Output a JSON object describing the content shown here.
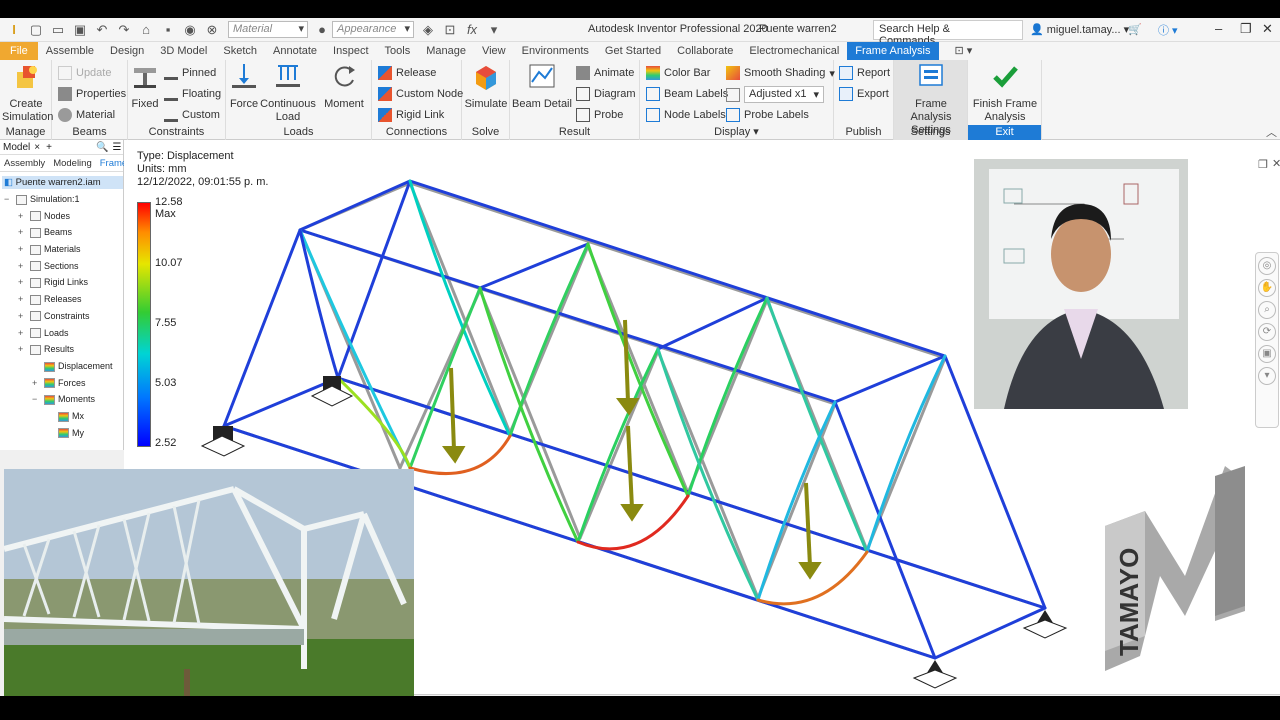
{
  "titlebar": {
    "material_placeholder": "Material",
    "appearance_placeholder": "Appearance",
    "app_title": "Autodesk Inventor Professional 2020",
    "doc_title": "Puente warren2",
    "search_placeholder": "Search Help & Commands...",
    "user": "miguel.tamay..."
  },
  "menu_tabs": [
    "File",
    "Assemble",
    "Design",
    "3D Model",
    "Sketch",
    "Annotate",
    "Inspect",
    "Tools",
    "Manage",
    "View",
    "Environments",
    "Get Started",
    "Collaborate",
    "Electromechanical",
    "Frame Analysis"
  ],
  "ribbon": {
    "manage": {
      "title": "Manage",
      "create_simulation": "Create Simulation"
    },
    "beams": {
      "title": "Beams",
      "update": "Update",
      "properties": "Properties",
      "material": "Material"
    },
    "constraints": {
      "title": "Constraints",
      "fixed": "Fixed",
      "pinned": "Pinned",
      "floating": "Floating",
      "custom": "Custom"
    },
    "loads": {
      "title": "Loads",
      "force": "Force",
      "continuous_load": "Continuous Load",
      "moment": "Moment"
    },
    "connections": {
      "title": "Connections",
      "release": "Release",
      "custom_node": "Custom Node",
      "rigid_link": "Rigid Link"
    },
    "solve": {
      "title": "Solve",
      "simulate": "Simulate"
    },
    "result": {
      "title": "Result",
      "beam_detail": "Beam Detail",
      "animate": "Animate",
      "diagram": "Diagram",
      "probe": "Probe"
    },
    "display": {
      "title": "Display",
      "color_bar": "Color Bar",
      "beam_labels": "Beam Labels",
      "node_labels": "Node Labels",
      "smooth_shading": "Smooth Shading",
      "adjusted": "Adjusted x1",
      "probe_labels": "Probe Labels"
    },
    "publish": {
      "title": "Publish",
      "report": "Report",
      "export": "Export"
    },
    "settings": {
      "title": "Settings",
      "frame_analysis_settings": "Frame Analysis Settings"
    },
    "exit": {
      "title": "Exit",
      "finish": "Finish Frame Analysis"
    }
  },
  "browser": {
    "header": "Model",
    "tabs": [
      "Assembly",
      "Modeling",
      "Frame"
    ],
    "root": "Puente warren2.iam",
    "items": [
      {
        "label": "Simulation:1",
        "indent": 0
      },
      {
        "label": "Nodes",
        "indent": 1
      },
      {
        "label": "Beams",
        "indent": 1
      },
      {
        "label": "Materials",
        "indent": 1
      },
      {
        "label": "Sections",
        "indent": 1
      },
      {
        "label": "Rigid Links",
        "indent": 1
      },
      {
        "label": "Releases",
        "indent": 1
      },
      {
        "label": "Constraints",
        "indent": 1
      },
      {
        "label": "Loads",
        "indent": 1
      },
      {
        "label": "Results",
        "indent": 1
      },
      {
        "label": "Displacement",
        "indent": 2
      },
      {
        "label": "Forces",
        "indent": 2
      },
      {
        "label": "Moments",
        "indent": 2
      },
      {
        "label": "Mx",
        "indent": 3
      },
      {
        "label": "My",
        "indent": 3
      }
    ]
  },
  "viewport": {
    "type_line": "Type: Displacement",
    "units_line": "Units: mm",
    "date_line": "12/12/2022, 09:01:55 p. m.",
    "legend": [
      "12.58 Max",
      "10.07",
      "7.55",
      "5.03",
      "2.52"
    ]
  },
  "logo_text": "TAMAYO",
  "colors": {
    "accent": "#1e7bd6",
    "file_tab": "#f0a830",
    "exit_green": "#1a9e3a"
  }
}
